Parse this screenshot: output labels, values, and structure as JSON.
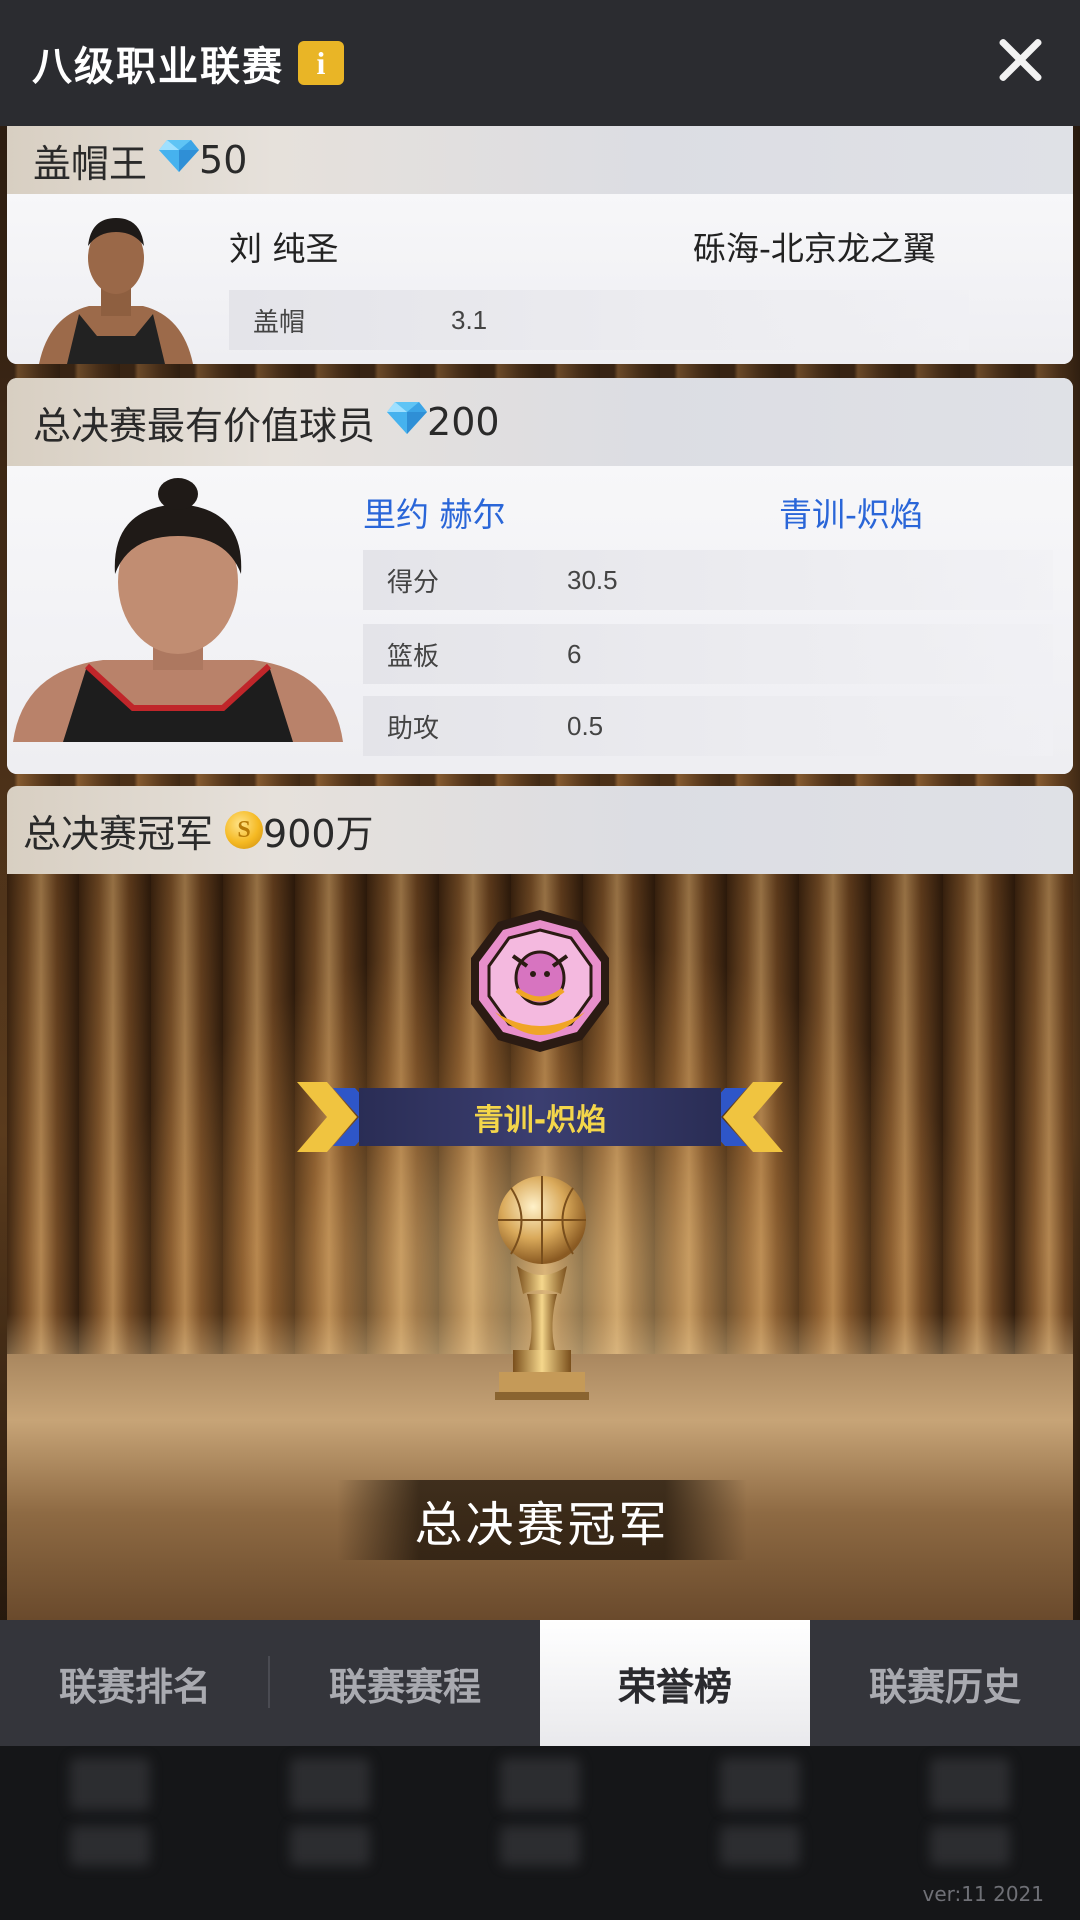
{
  "header": {
    "title": "八级职业联赛",
    "info_icon": "info-icon",
    "close_icon": "close-icon"
  },
  "awards": [
    {
      "title": "盖帽王",
      "reward_icon": "diamond-icon",
      "reward_value": "50",
      "player": "刘 纯圣",
      "team": "砾海-北京龙之翼",
      "stats": [
        {
          "label": "盖帽",
          "value": "3.1"
        }
      ]
    },
    {
      "title": "总决赛最有价值球员",
      "reward_icon": "diamond-icon",
      "reward_value": "200",
      "player": "里约 赫尔",
      "team": "青训-炽焰",
      "stats": [
        {
          "label": "得分",
          "value": "30.5"
        },
        {
          "label": "篮板",
          "value": "6"
        },
        {
          "label": "助攻",
          "value": "0.5"
        }
      ]
    },
    {
      "title": "总决赛冠军",
      "reward_icon": "coin-icon",
      "coin_symbol": "S",
      "reward_value": "900万",
      "team": "青训-炽焰",
      "trophy_label": "总决赛冠军"
    }
  ],
  "colors": {
    "accent_blue": "#2a66d8",
    "ribbon_gold": "#f4d64a",
    "header_bg": "#2b2c30",
    "info_badge": "#e9b526"
  },
  "tabs": [
    {
      "label": "联赛排名",
      "active": false
    },
    {
      "label": "联赛赛程",
      "active": false
    },
    {
      "label": "荣誉榜",
      "active": true
    },
    {
      "label": "联赛历史",
      "active": false
    }
  ],
  "footer": {
    "version": "ver:11  2021"
  }
}
